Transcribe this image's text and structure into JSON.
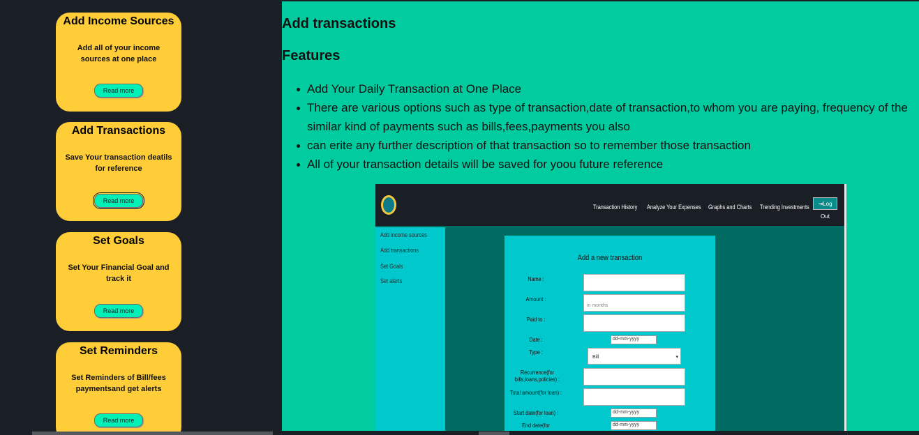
{
  "sidebar": {
    "cards": [
      {
        "title": "Add Income Sources",
        "desc": "Add all of your income sources at one place",
        "button": "Read more"
      },
      {
        "title": "Add Transactions",
        "desc": "Save Your transaction deatils for reference",
        "button": "Read more"
      },
      {
        "title": "Set Goals",
        "desc": "Set Your Financial Goal and track it",
        "button": "Read more"
      },
      {
        "title": "Set Reminders",
        "desc": "Set Reminders of Bill/fees paymentsand get alerts",
        "button": "Read more"
      }
    ]
  },
  "main": {
    "heading": "Add transactions",
    "subheading": "Features",
    "features": [
      "Add Your Daily Transaction at One Place",
      "There are various options such as type of transaction,date of transaction,to whom you are paying, frequency of the similar kind of payments such as bills,fees,payments you also",
      "can erite any further description of that transaction so to remember those transaction",
      "All of your transaction details will be saved for yoou future reference"
    ]
  },
  "screenshot": {
    "nav": [
      "Transaction History",
      "Analyze Your Expenses",
      "Graphs and Charts",
      "Trending Investments"
    ],
    "logout": "⇥Log Out",
    "side": [
      "Add income sources",
      "Add transactions",
      "Set Goals",
      "Set alerts"
    ],
    "form": {
      "title": "Add a new transaction",
      "name_label": "Name :",
      "amount_label": "Amount :",
      "amount_placeholder": "in months",
      "paid_to_label": "Paid to :",
      "date_label": "Date :",
      "date_value": "dd-mm-yyyy",
      "type_label": "Type :",
      "type_value": "Bill",
      "recurrence_label": "Recurrence(for bills,loans,policies) :",
      "total_label": "Total amount(for loan) :",
      "start_label": "Start date(for loan) :",
      "start_value": "dd-mm-yyyy",
      "end_label": "End date(for",
      "end_value": "dd-mm-yyyy"
    }
  },
  "colors": {
    "sidebar_bg": "#1a1f26",
    "card_bg": "#ffcd38",
    "button_bg": "#00f0b8",
    "main_bg": "#00cc9f"
  }
}
